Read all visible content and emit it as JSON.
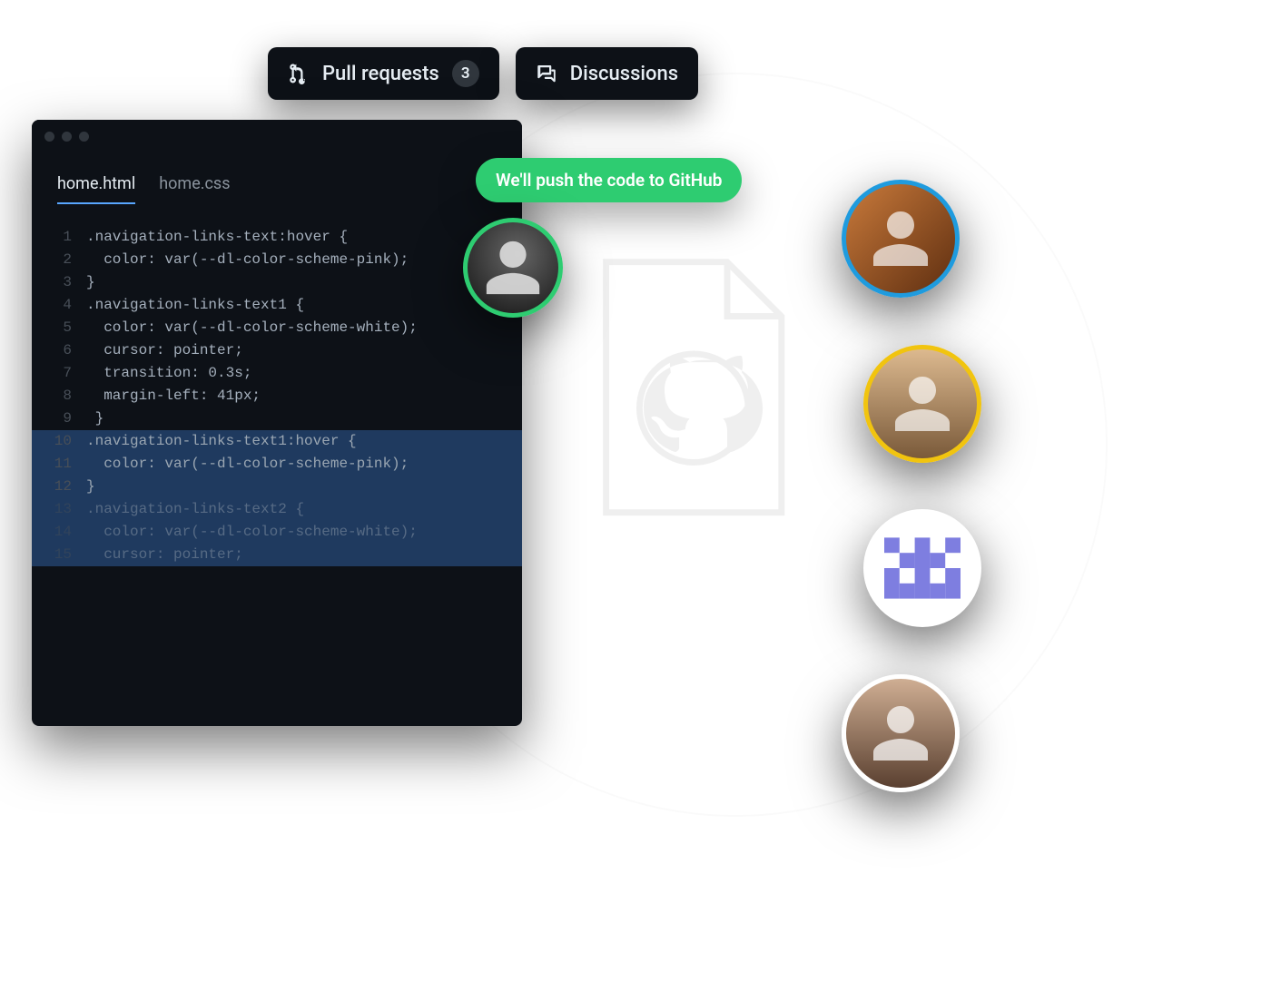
{
  "topTabs": {
    "pullRequests": {
      "label": "Pull requests",
      "badge": "3"
    },
    "discussions": {
      "label": "Discussions"
    }
  },
  "editor": {
    "tabs": {
      "active": "home.html",
      "inactive": "home.css"
    },
    "lines": [
      {
        "n": "1",
        "t": ".navigation-links-text:hover {"
      },
      {
        "n": "2",
        "t": "  color: var(--dl-color-scheme-pink);"
      },
      {
        "n": "3",
        "t": "}"
      },
      {
        "n": "4",
        "t": ".navigation-links-text1 {"
      },
      {
        "n": "5",
        "t": "  color: var(--dl-color-scheme-white);"
      },
      {
        "n": "6",
        "t": "  cursor: pointer;"
      },
      {
        "n": "7",
        "t": "  transition: 0.3s;"
      },
      {
        "n": "8",
        "t": "  margin-left: 41px;"
      },
      {
        "n": "9",
        "t": " }"
      },
      {
        "n": "10",
        "t": ".navigation-links-text1:hover {"
      },
      {
        "n": "11",
        "t": "  color: var(--dl-color-scheme-pink);"
      },
      {
        "n": "12",
        "t": "}"
      },
      {
        "n": "13",
        "t": ".navigation-links-text2 {"
      },
      {
        "n": "14",
        "t": "  color: var(--dl-color-scheme-white);"
      },
      {
        "n": "15",
        "t": "  cursor: pointer;"
      }
    ]
  },
  "tooltip": {
    "text": "We'll push the code to GitHub"
  },
  "colors": {
    "accentGreen": "#2ecc71",
    "editorBg": "#0d1117",
    "tabActiveUnderline": "#58a6ff",
    "avatarBorders": [
      "#1f9bde",
      "#f1c40f",
      "#ffffff",
      "#ffffff"
    ]
  },
  "icons": {
    "pullRequest": "git-pull-request-icon",
    "discussion": "comment-discussion-icon",
    "github": "github-mark-icon",
    "person": "person-silhouette-icon",
    "identicon": "identicon-pattern-icon"
  }
}
